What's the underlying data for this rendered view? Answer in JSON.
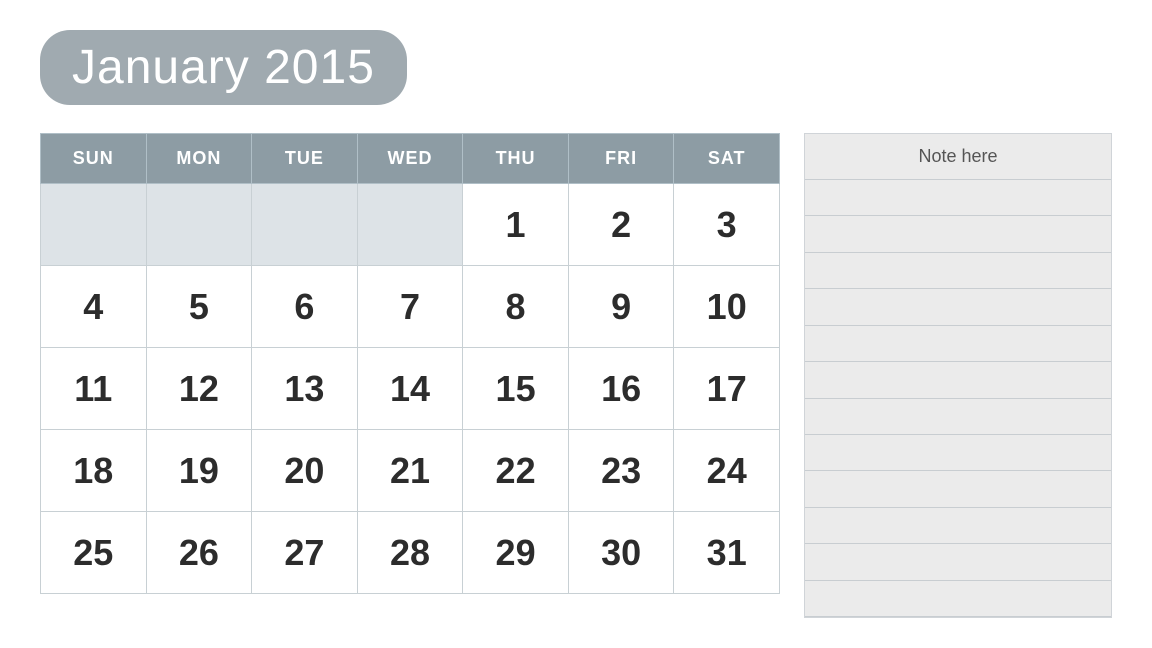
{
  "header": {
    "month_year": "January 2015"
  },
  "calendar": {
    "days_of_week": [
      "SUN",
      "MON",
      "TUE",
      "WED",
      "THU",
      "FRI",
      "SAT"
    ],
    "weeks": [
      [
        "",
        "",
        "",
        "",
        "1",
        "2",
        "3"
      ],
      [
        "4",
        "5",
        "6",
        "7",
        "8",
        "9",
        "10"
      ],
      [
        "11",
        "12",
        "13",
        "14",
        "15",
        "16",
        "17"
      ],
      [
        "18",
        "19",
        "20",
        "21",
        "22",
        "23",
        "24"
      ],
      [
        "25",
        "26",
        "27",
        "28",
        "29",
        "30",
        "31"
      ]
    ]
  },
  "notes": {
    "title": "Note here",
    "line_count": 12
  }
}
